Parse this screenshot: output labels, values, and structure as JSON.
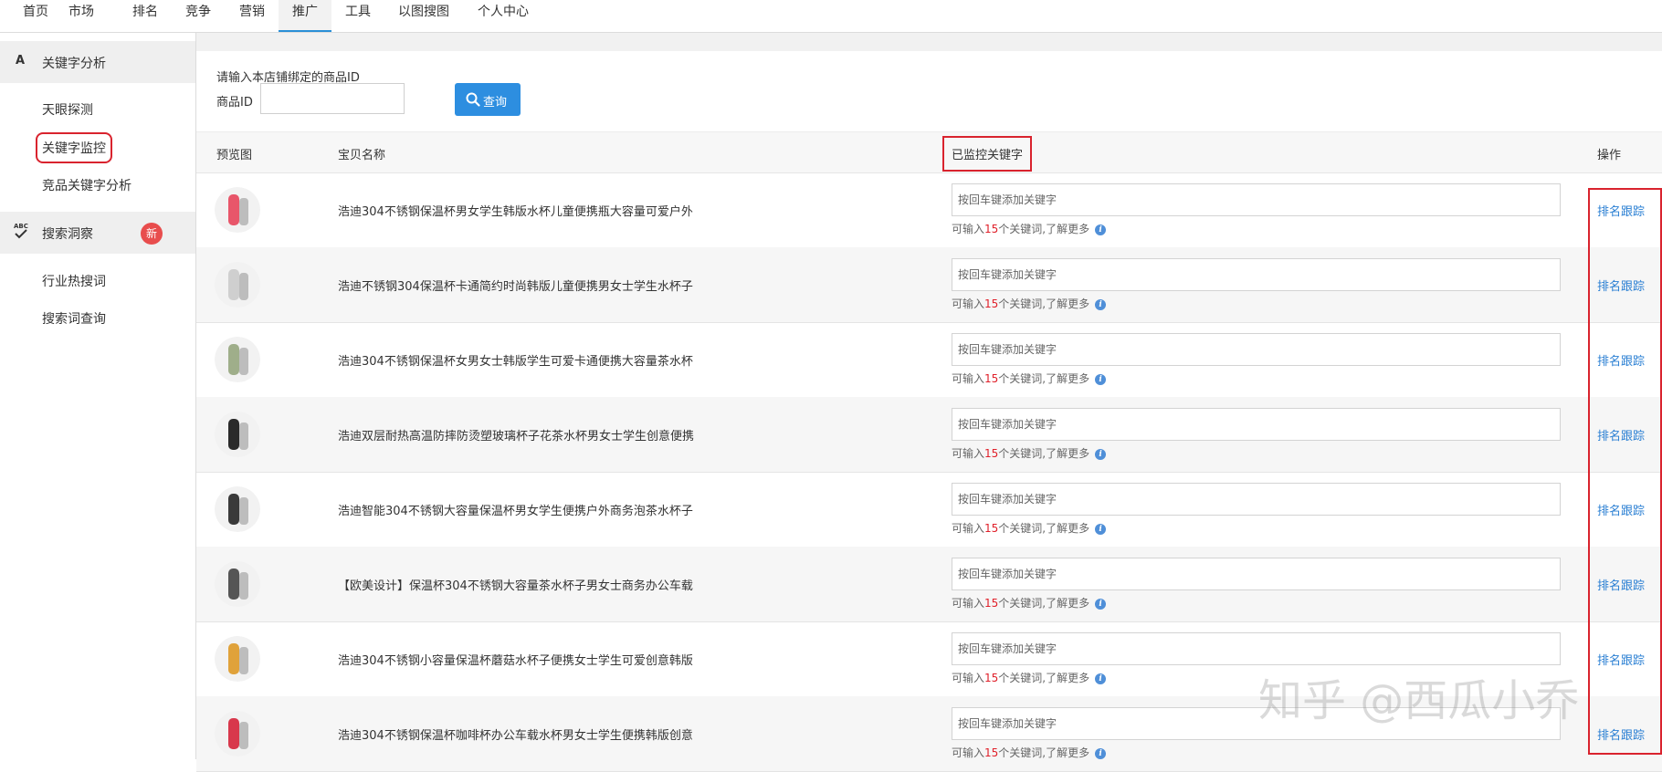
{
  "nav": {
    "tabs": [
      {
        "label": "首页"
      },
      {
        "label": "市场"
      },
      {
        "label": "排名"
      },
      {
        "label": "竞争"
      },
      {
        "label": "营销"
      },
      {
        "label": "推广"
      },
      {
        "label": "工具"
      },
      {
        "label": "以图搜图"
      },
      {
        "label": "个人中心"
      }
    ],
    "active": "推广"
  },
  "sidebar": {
    "sections": [
      {
        "icon": "A",
        "label": "关键字分析",
        "items": [
          {
            "label": "天眼探测"
          },
          {
            "label": "关键字监控",
            "highlighted": true
          },
          {
            "label": "竞品关键字分析"
          }
        ]
      },
      {
        "icon": "ABC-check-icon",
        "label": "搜索洞察",
        "badge": "新",
        "items": [
          {
            "label": "行业热搜词"
          },
          {
            "label": "搜索词查询"
          }
        ]
      }
    ]
  },
  "search": {
    "prompt": "请输入本店铺绑定的商品ID",
    "id_label": "商品ID",
    "id_value": "",
    "button_label": "查询"
  },
  "table": {
    "headers": {
      "preview": "预览图",
      "name": "宝贝名称",
      "keywords": "已监控关键字",
      "action": "操作"
    },
    "keyword_placeholder": "按回车键添加关键字",
    "hint_prefix": "可输入",
    "hint_num": "15",
    "hint_suffix": "个关键词,了解更多",
    "action_label": "排名跟踪",
    "rows": [
      {
        "name": "浩迪304不锈钢保温杯男女学生韩版水杯儿童便携瓶大容量可爱户外",
        "thumb_color": "#e8566a"
      },
      {
        "name": "浩迪不锈钢304保温杯卡通简约时尚韩版儿童便携男女士学生水杯子",
        "thumb_color": "#cfcfcf"
      },
      {
        "name": "浩迪304不锈钢保温杯女男女士韩版学生可爱卡通便携大容量茶水杯",
        "thumb_color": "#9fae8a"
      },
      {
        "name": "浩迪双层耐热高温防摔防烫塑玻璃杯子花茶水杯男女士学生创意便携",
        "thumb_color": "#2a2a2a"
      },
      {
        "name": "浩迪智能304不锈钢大容量保温杯男女学生便携户外商务泡茶水杯子",
        "thumb_color": "#3a3a3a"
      },
      {
        "name": "【欧美设计】保温杯304不锈钢大容量茶水杯子男女士商务办公车载",
        "thumb_color": "#555555"
      },
      {
        "name": "浩迪304不锈钢小容量保温杯蘑菇水杯子便携女士学生可爱创意韩版",
        "thumb_color": "#e0a23a"
      },
      {
        "name": "浩迪304不锈钢保温杯咖啡杯办公车载水杯男女士学生便携韩版创意",
        "thumb_color": "#d8384c"
      }
    ]
  },
  "watermark": "知乎 @西瓜小乔"
}
